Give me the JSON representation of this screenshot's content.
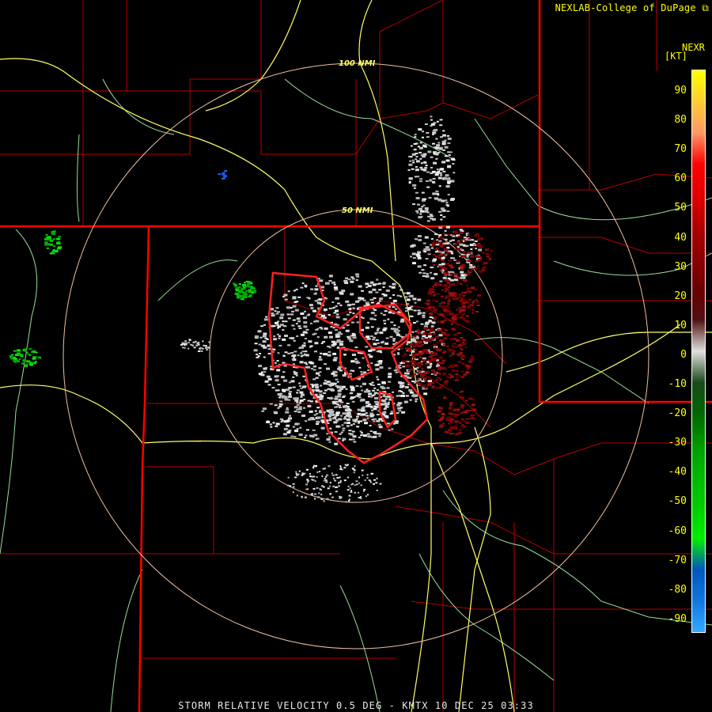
{
  "credit": "NEXLAB-College of DuPage",
  "credit_icon": "external-link-icon",
  "legend": {
    "title": "NEXR",
    "unit": "[KT]",
    "ticks": [
      "90",
      "80",
      "70",
      "60",
      "50",
      "40",
      "30",
      "20",
      "10",
      "0",
      "-10",
      "-20",
      "-30",
      "-40",
      "-50",
      "-60",
      "-70",
      "-80",
      "-90"
    ],
    "colors": [
      "#ffff00",
      "#ffcc33",
      "#ff9966",
      "#ff0000",
      "#e00000",
      "#b00000",
      "#8c0000",
      "#6a0000",
      "#501010",
      "#e0e0e0",
      "#1a4a1a",
      "#006600",
      "#009900",
      "#00b800",
      "#00cc00",
      "#00ee00",
      "#0055bb",
      "#1177dd",
      "#33aaff"
    ]
  },
  "range_rings": [
    "50 NMI",
    "100 NMI"
  ],
  "footer": "STORM RELATIVE VELOCITY 0.5 DEG - KMTX 10 DEC 25 03:33",
  "colors": {
    "state_border": "#ff0000",
    "county_line": "#b80000",
    "highway": "#ffff66",
    "road": "#99dd99",
    "ring": "#f0c0a0",
    "warning_polygon": "#ff2020"
  }
}
